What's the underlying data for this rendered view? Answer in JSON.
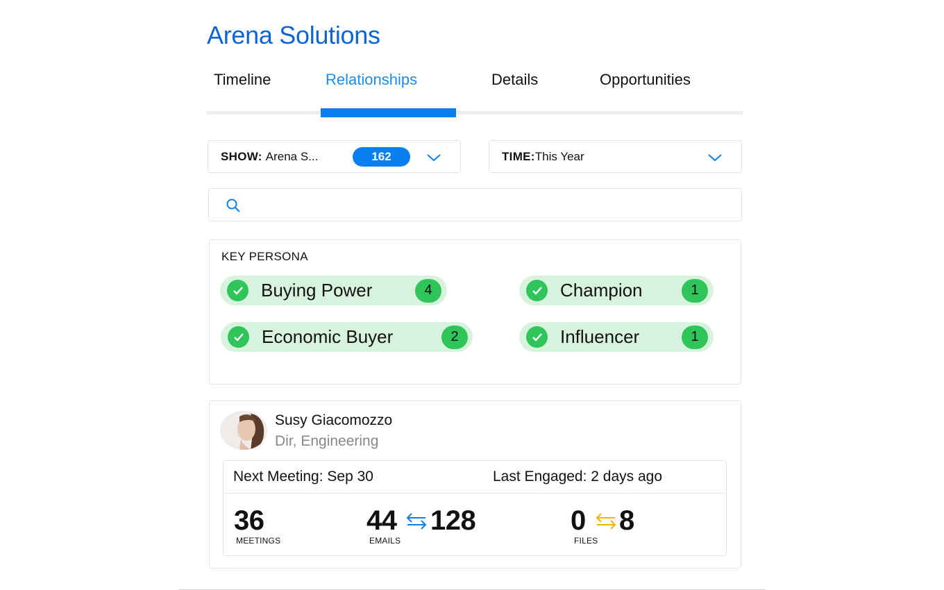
{
  "header": {
    "title": "Arena Solutions"
  },
  "tabs": [
    {
      "label": "Timeline",
      "active": false
    },
    {
      "label": "Relationships",
      "active": true
    },
    {
      "label": "Details",
      "active": false
    },
    {
      "label": "Opportunities",
      "active": false
    }
  ],
  "filters": {
    "show": {
      "label": "SHOW:",
      "value": "Arena S...",
      "count": "162"
    },
    "time": {
      "label": "TIME:",
      "value": "This Year"
    }
  },
  "search": {
    "icon": "search-icon",
    "placeholder": ""
  },
  "key_persona": {
    "heading": "KEY PERSONA",
    "items": [
      {
        "label": "Buying Power",
        "count": "4"
      },
      {
        "label": "Champion",
        "count": "1"
      },
      {
        "label": "Economic Buyer",
        "count": "2"
      },
      {
        "label": "Influencer",
        "count": "1"
      }
    ]
  },
  "contact": {
    "name": "Susy Giacomozzo",
    "role": "Dir, Engineering",
    "next_meeting_label": "Next Meeting: ",
    "next_meeting_value": "Sep 30",
    "last_engaged_label": "Last Engaged: ",
    "last_engaged_value": "2 days ago",
    "meetings": {
      "value": "36",
      "label": "MEETINGS"
    },
    "emails": {
      "sent": "44",
      "received": "128",
      "label": "EMAILS"
    },
    "files": {
      "sent": "0",
      "received": "8",
      "label": "FILES"
    }
  },
  "colors": {
    "brand": "#0a64d6",
    "accent": "#0b7ff0",
    "success": "#2fc55a",
    "success_bg": "#d8f3dd",
    "files_arrow": "#f0b400"
  }
}
